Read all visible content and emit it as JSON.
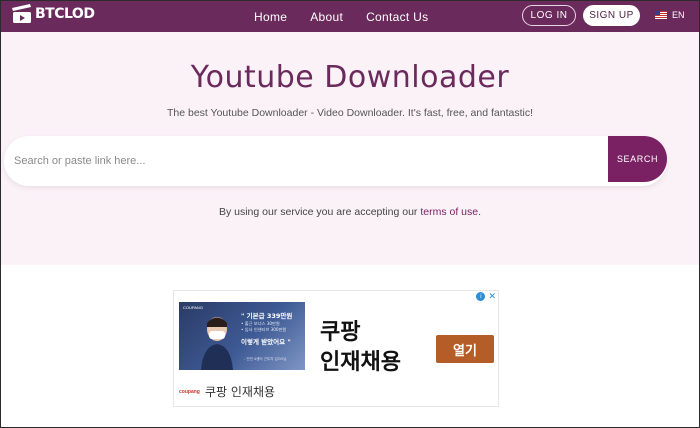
{
  "brand": {
    "name": "BTCLOD"
  },
  "nav": {
    "links": [
      "Home",
      "About",
      "Contact Us"
    ],
    "login": "LOG IN",
    "signup": "SIGN UP",
    "language": "EN"
  },
  "hero": {
    "title": "Youtube Downloader",
    "subtitle": "The best Youtube Downloader - Video Downloader. It's fast, free, and fantastic!",
    "search_placeholder": "Search or paste link here...",
    "search_button": "SEARCH",
    "terms_prefix": "By using our service you are accepting our ",
    "terms_link": "terms of use",
    "terms_suffix": "."
  },
  "ad": {
    "image_brand": "COUPANG",
    "image_line1": "\" 기본급 339만원",
    "image_line2a": "• 출근 보너스 30만원",
    "image_line2b": "• 입사 인센티브 300만원",
    "image_line3": "이렇게 받았어요 \"",
    "image_line4": "- 인천 4센터 근무자 김OO님",
    "headline_line1": "쿠팡",
    "headline_line2": "인재채용",
    "cta": "열기",
    "footer_logo": "coupang",
    "footer_text": "쿠팡 인재채용",
    "info_icon": "i",
    "close_icon": "✕"
  },
  "colors": {
    "nav_bg": "#6b2a5c",
    "hero_bg": "#fbf2f8",
    "accent": "#7a2163",
    "ad_cta": "#b55d27"
  }
}
